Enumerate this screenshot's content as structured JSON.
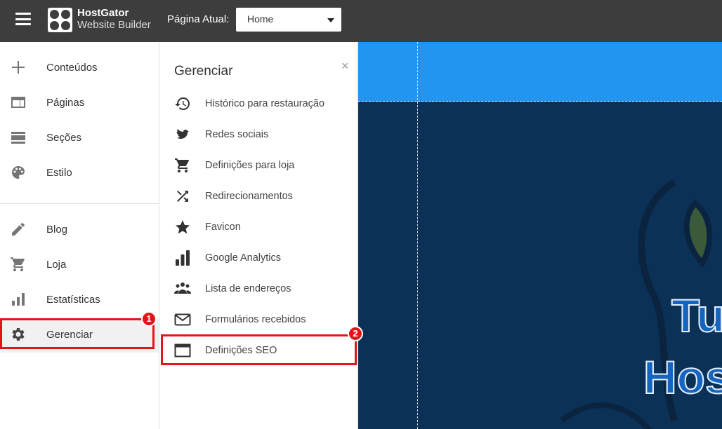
{
  "topbar": {
    "brand_line1": "HostGator",
    "brand_line2": "Website Builder",
    "page_label": "Página Atual:",
    "page_selected": "Home"
  },
  "sidebar": {
    "items": [
      {
        "label": "Conteúdos",
        "icon": "plus-icon"
      },
      {
        "label": "Páginas",
        "icon": "pages-icon"
      },
      {
        "label": "Seções",
        "icon": "sections-icon"
      },
      {
        "label": "Estilo",
        "icon": "palette-icon"
      },
      {
        "label": "Blog",
        "icon": "pencil-icon"
      },
      {
        "label": "Loja",
        "icon": "cart-icon"
      },
      {
        "label": "Estatísticas",
        "icon": "bar-chart-icon"
      },
      {
        "label": "Gerenciar",
        "icon": "gear-icon"
      }
    ]
  },
  "panel": {
    "title": "Gerenciar",
    "close": "×",
    "items": [
      {
        "label": "Histórico para restauração",
        "icon": "history-icon"
      },
      {
        "label": "Redes sociais",
        "icon": "bird-icon"
      },
      {
        "label": "Definições para loja",
        "icon": "cart-icon"
      },
      {
        "label": "Redirecionamentos",
        "icon": "shuffle-icon"
      },
      {
        "label": "Favicon",
        "icon": "star-icon"
      },
      {
        "label": "Google Analytics",
        "icon": "analytics-icon"
      },
      {
        "label": "Lista de endereços",
        "icon": "people-icon"
      },
      {
        "label": "Formulários recebidos",
        "icon": "envelope-icon"
      },
      {
        "label": "Definições SEO",
        "icon": "browser-window-icon"
      }
    ]
  },
  "annotations": {
    "badge1": "1",
    "badge2": "2"
  },
  "canvas": {
    "text_line1": "Tu",
    "text_line2": "Hos"
  },
  "colors": {
    "topbar": "#3d3d3d",
    "highlight": "#e0161c",
    "canvas_header": "#2394f0",
    "canvas_bg": "#0c3157"
  }
}
